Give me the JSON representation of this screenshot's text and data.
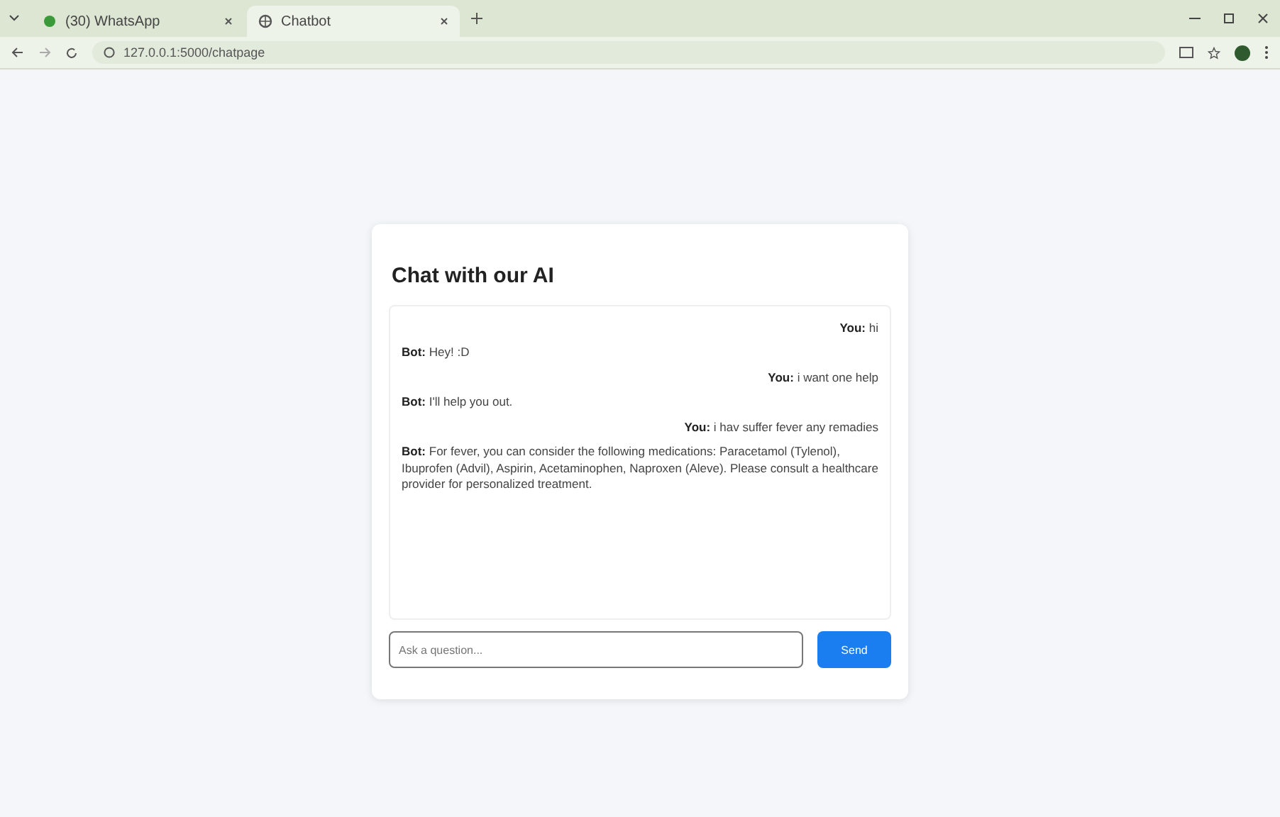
{
  "browser": {
    "tabs": [
      {
        "title": "(30) WhatsApp",
        "kind": "whatsapp",
        "selected": false
      },
      {
        "title": "Chatbot",
        "kind": "globe",
        "selected": true
      }
    ],
    "url": "127.0.0.1:5000/chatpage"
  },
  "chat": {
    "title": "Chat with our AI",
    "messages": [
      {
        "kind": "user",
        "sender": "You:",
        "text": "hi"
      },
      {
        "kind": "bot",
        "sender": "Bot:",
        "text": "Hey! :D"
      },
      {
        "kind": "user",
        "sender": "You:",
        "text": "i want one help"
      },
      {
        "kind": "bot",
        "sender": "Bot:",
        "text": "I'll help you out."
      },
      {
        "kind": "user",
        "sender": "You:",
        "text": "i hav suffer fever any remadies"
      },
      {
        "kind": "bot",
        "sender": "Bot:",
        "text": "For fever, you can consider the following medications: Paracetamol (Tylenol), Ibuprofen (Advil), Aspirin, Acetaminophen, Naproxen (Aleve). Please consult a healthcare provider for personalized treatment."
      }
    ],
    "input": {
      "placeholder": "Ask a question..."
    },
    "send": "Send"
  }
}
